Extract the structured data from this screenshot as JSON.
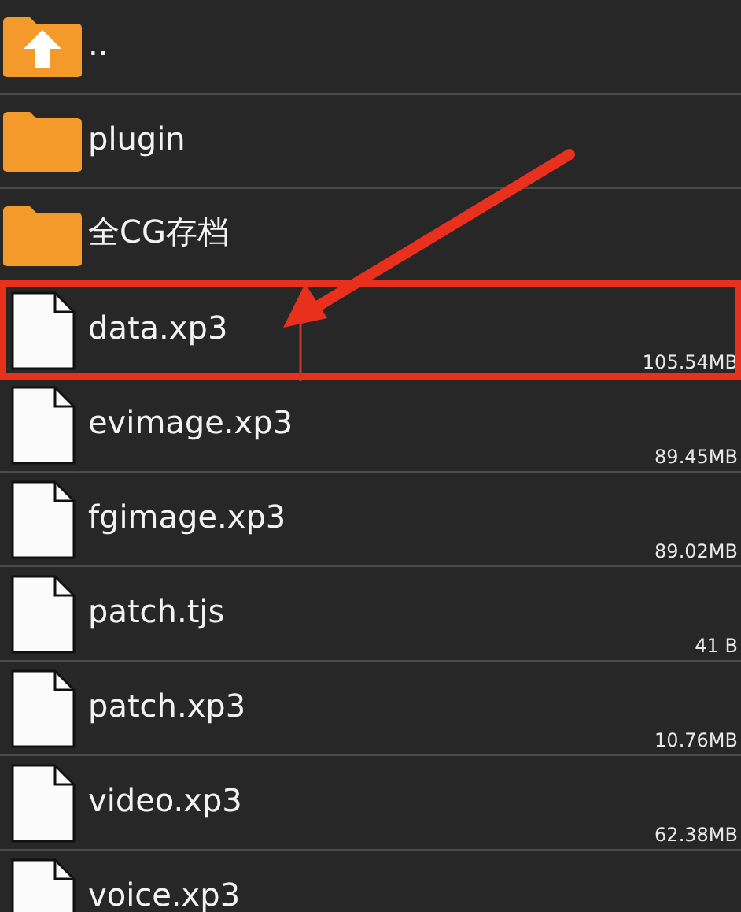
{
  "files": [
    {
      "kind": "up",
      "name": "..",
      "highlighted": false
    },
    {
      "kind": "folder",
      "name": "plugin",
      "highlighted": false
    },
    {
      "kind": "folder",
      "name": "全CG存档",
      "highlighted": false
    },
    {
      "kind": "file",
      "name": "data.xp3",
      "size": "105.54MB",
      "highlighted": true
    },
    {
      "kind": "file",
      "name": "evimage.xp3",
      "size": "89.45MB",
      "highlighted": false
    },
    {
      "kind": "file",
      "name": "fgimage.xp3",
      "size": "89.02MB",
      "highlighted": false
    },
    {
      "kind": "file",
      "name": "patch.tjs",
      "size": "41 B",
      "highlighted": false
    },
    {
      "kind": "file",
      "name": "patch.xp3",
      "size": "10.76MB",
      "highlighted": false
    },
    {
      "kind": "file",
      "name": "video.xp3",
      "size": "62.38MB",
      "highlighted": false
    },
    {
      "kind": "file",
      "name": "voice.xp3",
      "highlighted": false
    }
  ]
}
